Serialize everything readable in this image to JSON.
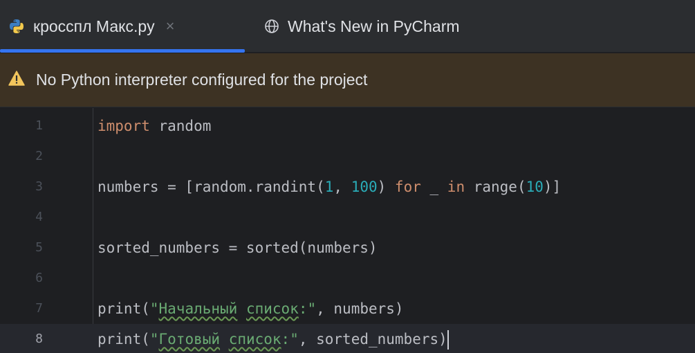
{
  "tabs": [
    {
      "label": "кросспл Макс.py",
      "icon": "python-file-icon",
      "active": true,
      "close": "×"
    },
    {
      "label": "What's New in PyCharm",
      "icon": "globe-icon",
      "active": false
    }
  ],
  "banner": {
    "icon": "warning-icon",
    "text": "No Python interpreter configured for the project"
  },
  "editor": {
    "current_line": 8,
    "lines": [
      {
        "number": "1",
        "text": "import random"
      },
      {
        "number": "2",
        "text": ""
      },
      {
        "number": "3",
        "text": "numbers = [random.randint(1, 100) for _ in range(10)]"
      },
      {
        "number": "4",
        "text": ""
      },
      {
        "number": "5",
        "text": "sorted_numbers = sorted(numbers)"
      },
      {
        "number": "6",
        "text": ""
      },
      {
        "number": "7",
        "text": "print(\"Начальный список:\", numbers)"
      },
      {
        "number": "8",
        "text": "print(\"Готовый список:\", sorted_numbers)"
      }
    ],
    "tokens": {
      "l1_kw": "import",
      "l1_rest": " random",
      "l3_a": "numbers = [random.randint(",
      "l3_n1": "1",
      "l3_b": ", ",
      "l3_n2": "100",
      "l3_c": ") ",
      "l3_kw1": "for",
      "l3_d": " _ ",
      "l3_kw2": "in",
      "l3_e": " range(",
      "l3_n3": "10",
      "l3_f": ")]",
      "l5": "sorted_numbers = sorted(numbers)",
      "l7_a": "print(",
      "l7_q1": "\"",
      "l7_w1": "Начальный",
      "l7_sp": " ",
      "l7_w2": "список",
      "l7_q2": ":\"",
      "l7_b": ", numbers)",
      "l8_a": "print(",
      "l8_q1": "\"",
      "l8_w1": "Готовый",
      "l8_sp": " ",
      "l8_w2": "список",
      "l8_q2": ":\"",
      "l8_b": ", sorted_numbers)"
    }
  },
  "colors": {
    "accent": "#3574f0",
    "keyword": "#cf8e6d",
    "number": "#2aacb8",
    "string": "#6aab73",
    "warning": "#f2c55c",
    "banner_bg": "#3d3223"
  }
}
